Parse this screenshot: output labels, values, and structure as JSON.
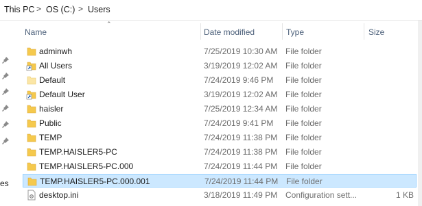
{
  "breadcrumb": {
    "items": [
      "This PC",
      "OS (C:)",
      "Users"
    ],
    "separator": ">"
  },
  "nav_fragment": "es",
  "columns": {
    "name": "Name",
    "date": "Date modified",
    "type": "Type",
    "size": "Size"
  },
  "icons": {
    "folder": "folder-icon",
    "shortcut": "shortcut-folder-icon",
    "file": "settings-file-icon",
    "pin": "pin-icon"
  },
  "colors": {
    "folder": "#f5c94d",
    "selection": "#cce8ff",
    "selection_border": "#99d1ff",
    "header_text": "#4c607a"
  },
  "rows": [
    {
      "name": "adminwh",
      "date": "7/25/2019 10:30 AM",
      "type": "File folder",
      "size": "",
      "icon": "folder",
      "selected": false
    },
    {
      "name": "All Users",
      "date": "3/19/2019 12:02 AM",
      "type": "File folder",
      "size": "",
      "icon": "shortcut",
      "selected": false
    },
    {
      "name": "Default",
      "date": "7/24/2019 9:46 PM",
      "type": "File folder",
      "size": "",
      "icon": "folder-light",
      "selected": false
    },
    {
      "name": "Default User",
      "date": "3/19/2019 12:02 AM",
      "type": "File folder",
      "size": "",
      "icon": "shortcut",
      "selected": false
    },
    {
      "name": "haisler",
      "date": "7/25/2019 12:34 AM",
      "type": "File folder",
      "size": "",
      "icon": "folder",
      "selected": false
    },
    {
      "name": "Public",
      "date": "7/24/2019 9:41 PM",
      "type": "File folder",
      "size": "",
      "icon": "folder",
      "selected": false
    },
    {
      "name": "TEMP",
      "date": "7/24/2019 11:38 PM",
      "type": "File folder",
      "size": "",
      "icon": "folder",
      "selected": false
    },
    {
      "name": "TEMP.HAISLER5-PC",
      "date": "7/24/2019 11:38 PM",
      "type": "File folder",
      "size": "",
      "icon": "folder",
      "selected": false
    },
    {
      "name": "TEMP.HAISLER5-PC.000",
      "date": "7/24/2019 11:44 PM",
      "type": "File folder",
      "size": "",
      "icon": "folder",
      "selected": false
    },
    {
      "name": "TEMP.HAISLER5-PC.000.001",
      "date": "7/24/2019 11:44 PM",
      "type": "File folder",
      "size": "",
      "icon": "folder",
      "selected": true
    },
    {
      "name": "desktop.ini",
      "date": "3/18/2019 11:49 PM",
      "type": "Configuration sett...",
      "size": "1 KB",
      "icon": "file",
      "selected": false
    }
  ]
}
